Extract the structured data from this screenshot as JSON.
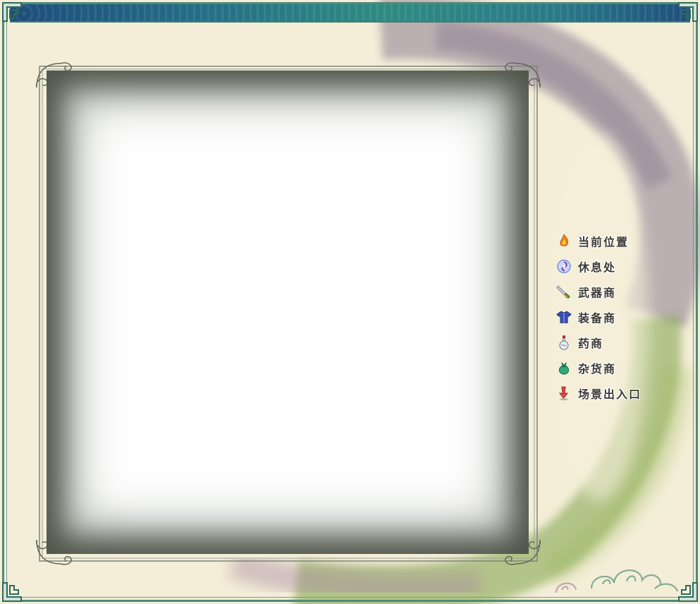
{
  "colors": {
    "frame": "#4f8a78",
    "title_bar": "#246a86",
    "parchment": "#f4eed8",
    "map_edge": "#4e5449",
    "label_text": "#3c3a37",
    "brush_purple": "#8c7b92",
    "brush_green": "#7ea24a"
  },
  "legend": {
    "items": [
      {
        "icon": "flame-icon",
        "label": "当前位置"
      },
      {
        "icon": "swirl-orb-icon",
        "label": "休息处"
      },
      {
        "icon": "sword-icon",
        "label": "武器商"
      },
      {
        "icon": "robe-icon",
        "label": "装备商"
      },
      {
        "icon": "potion-bottle-icon",
        "label": "药商"
      },
      {
        "icon": "money-bag-icon",
        "label": "杂货商"
      },
      {
        "icon": "exit-arrow-icon",
        "label": "场景出入口"
      }
    ]
  }
}
